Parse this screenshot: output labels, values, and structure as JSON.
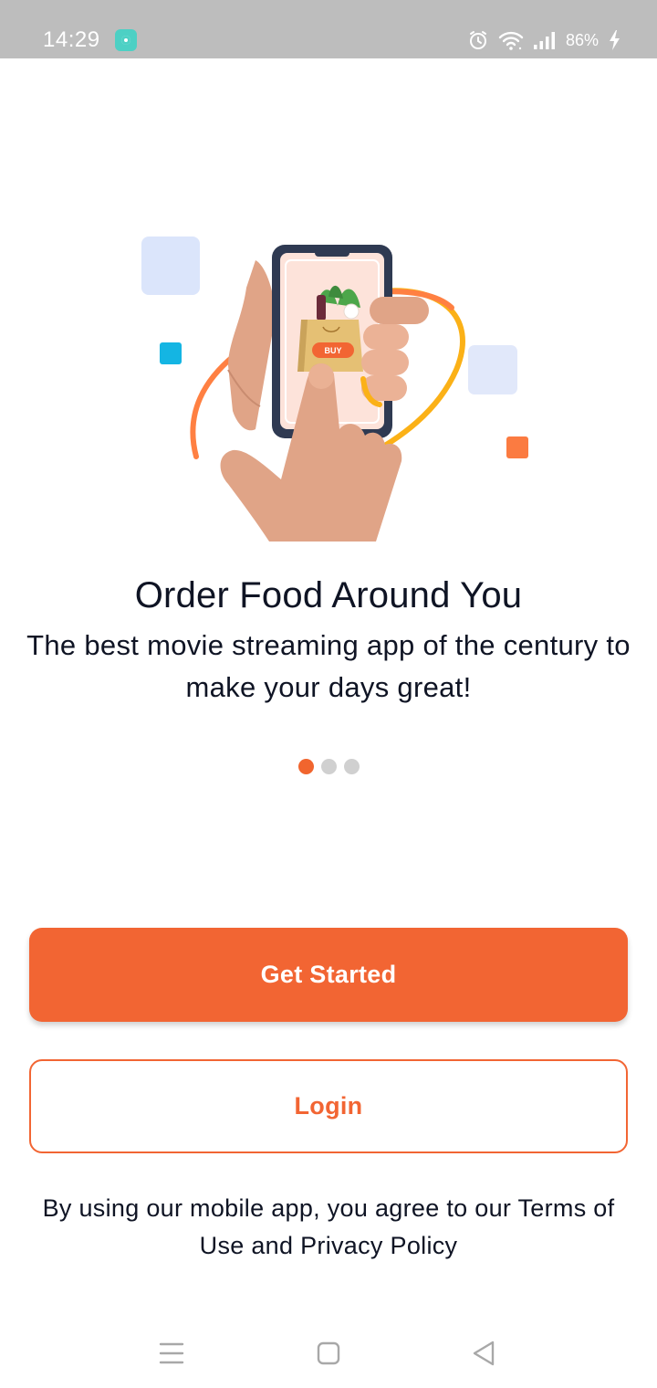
{
  "status_bar": {
    "time": "14:29",
    "battery_percent": "86%",
    "icons": [
      "app-notification-icon",
      "alarm-icon",
      "wifi-icon",
      "signal-icon",
      "battery-charging-icon"
    ]
  },
  "onboarding": {
    "title": "Order Food Around You",
    "subtitle": "The best movie streaming app of the century to make your days great!",
    "illustration_badge": "BUY",
    "pages_total": 3,
    "current_page": 1
  },
  "actions": {
    "get_started_label": "Get Started",
    "login_label": "Login"
  },
  "legal": {
    "text": "By using our mobile app, you agree to our Terms of Use and Privacy Policy"
  },
  "navigation_bar": {
    "icons": [
      "menu-icon",
      "home-icon",
      "back-icon"
    ]
  },
  "colors": {
    "accent": "#f26533",
    "status_bar": "#bdbdbd",
    "text": "#0f1424",
    "dot_inactive": "#d0d0d0"
  }
}
